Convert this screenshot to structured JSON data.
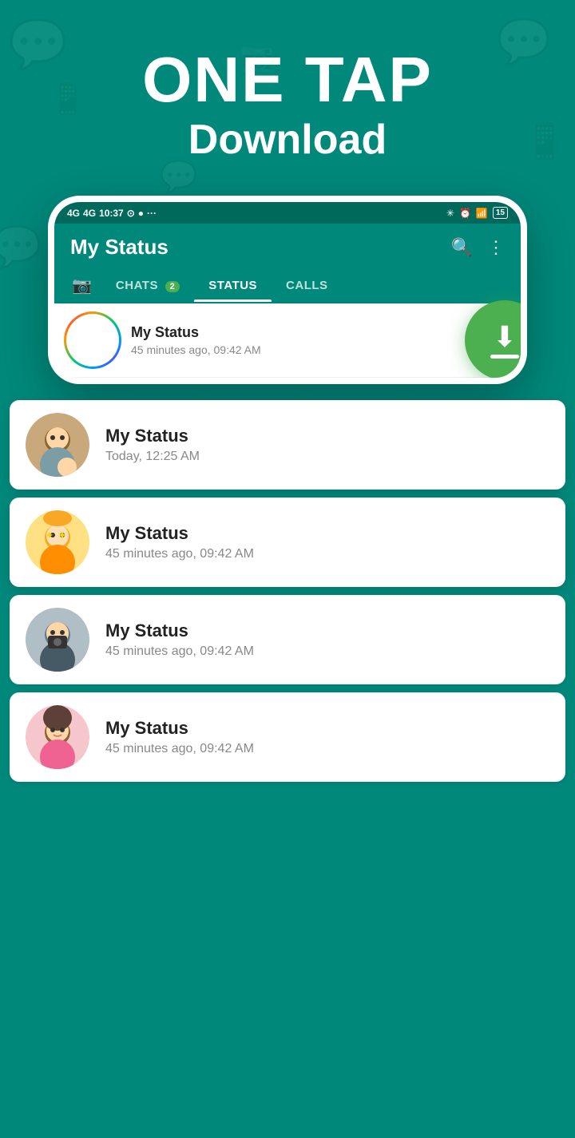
{
  "hero": {
    "main_text": "ONE TAP",
    "sub_text": "Download"
  },
  "status_bar": {
    "signal1": "4G",
    "signal2": "4G",
    "time": "10:37",
    "battery": "15"
  },
  "app_bar": {
    "title": "My Status",
    "search_label": "search",
    "menu_label": "menu"
  },
  "tabs": [
    {
      "id": "camera",
      "label": "📷",
      "type": "icon"
    },
    {
      "id": "chats",
      "label": "CHATS",
      "badge": "2",
      "active": false
    },
    {
      "id": "status",
      "label": "STATUS",
      "active": true
    },
    {
      "id": "calls",
      "label": "CALLS",
      "active": false
    }
  ],
  "phone_status_item": {
    "name": "My Status",
    "time": "45 minutes ago, 09:42 AM"
  },
  "list_items": [
    {
      "id": 1,
      "name": "My Status",
      "time": "Today, 12:25 AM",
      "bg": "#e8d5c4",
      "emoji": "👨‍👧"
    },
    {
      "id": 2,
      "name": "My Status",
      "time": "45 minutes ago, 09:42 AM",
      "bg": "#FFE082",
      "emoji": "🤩"
    },
    {
      "id": 3,
      "name": "My Status",
      "time": "45 minutes ago, 09:42 AM",
      "bg": "#b0bec5",
      "emoji": "📷"
    },
    {
      "id": 4,
      "name": "My Status",
      "time": "45 minutes ago, 09:42 AM",
      "bg": "#f5c6cb",
      "emoji": "👩"
    }
  ],
  "download_button": {
    "aria_label": "Download"
  },
  "colors": {
    "primary": "#00897B",
    "dark_primary": "#00695C",
    "accent": "#4CAF50",
    "white": "#ffffff"
  }
}
